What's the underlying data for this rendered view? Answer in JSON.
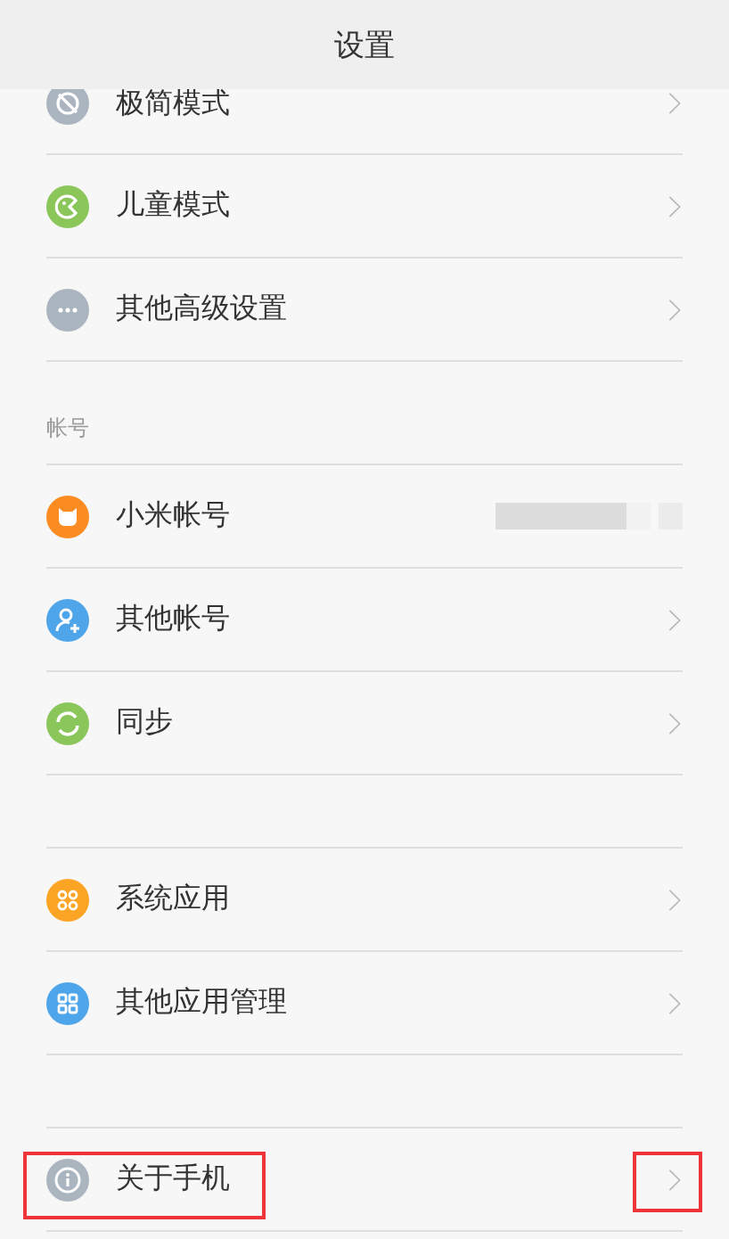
{
  "header": {
    "title": "设置"
  },
  "groups": [
    {
      "items": [
        {
          "label": "极简模式",
          "color": "#aab5c0",
          "chevron": true,
          "redacted": false,
          "highlighted": false
        },
        {
          "label": "儿童模式",
          "color": "#8bc65a",
          "chevron": true,
          "redacted": false,
          "highlighted": false
        },
        {
          "label": "其他高级设置",
          "color": "#aab5c0",
          "chevron": true,
          "redacted": false,
          "highlighted": false
        }
      ]
    },
    {
      "label": "帐号",
      "items": [
        {
          "label": "小米帐号",
          "color": "#fb8c22",
          "chevron": false,
          "redacted": true,
          "highlighted": false
        },
        {
          "label": "其他帐号",
          "color": "#4fa5ea",
          "chevron": true,
          "redacted": false,
          "highlighted": false
        },
        {
          "label": "同步",
          "color": "#8bc65a",
          "chevron": true,
          "redacted": false,
          "highlighted": false
        }
      ]
    },
    {
      "items": [
        {
          "label": "系统应用",
          "color": "#fca424",
          "chevron": true,
          "redacted": false,
          "highlighted": false
        },
        {
          "label": "其他应用管理",
          "color": "#4fa5ea",
          "chevron": true,
          "redacted": false,
          "highlighted": false
        }
      ]
    },
    {
      "items": [
        {
          "label": "关于手机",
          "color": "#aab5c0",
          "chevron": true,
          "redacted": false,
          "highlighted": true
        }
      ]
    }
  ]
}
